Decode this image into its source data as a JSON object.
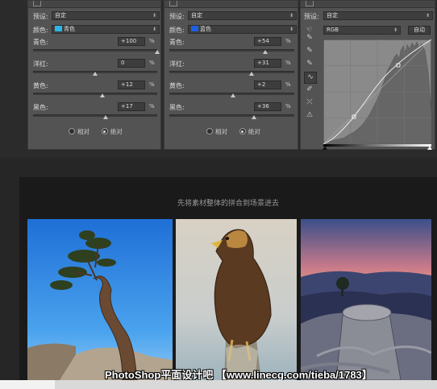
{
  "panel1": {
    "preset_label": "预设:",
    "preset_value": "自定",
    "color_label": "颜色:",
    "color_value": "青色",
    "color_swatch": "#2bb8e8",
    "sliders": [
      {
        "label": "青色:",
        "value": "+100",
        "unit": "%",
        "level": 1.0
      },
      {
        "label": "洋红:",
        "value": "0",
        "unit": "%",
        "level": 0.5
      },
      {
        "label": "黄色:",
        "value": "+12",
        "unit": "%",
        "level": 0.56
      },
      {
        "label": "黑色:",
        "value": "+17",
        "unit": "%",
        "level": 0.585
      }
    ],
    "radio_relative": "相对",
    "radio_absolute": "绝对",
    "selected": "absolute"
  },
  "panel2": {
    "preset_label": "预设:",
    "preset_value": "自定",
    "color_label": "颜色:",
    "color_value": "蓝色",
    "color_swatch": "#1f5fe0",
    "sliders": [
      {
        "label": "青色:",
        "value": "+54",
        "unit": "%",
        "level": 0.77
      },
      {
        "label": "洋红:",
        "value": "+31",
        "unit": "%",
        "level": 0.655
      },
      {
        "label": "黄色:",
        "value": "+2",
        "unit": "%",
        "level": 0.51
      },
      {
        "label": "黑色:",
        "value": "+36",
        "unit": "%",
        "level": 0.68
      }
    ],
    "radio_relative": "相对",
    "radio_absolute": "绝对",
    "selected": "absolute"
  },
  "panel3": {
    "preset_label": "预设:",
    "preset_value": "自定",
    "channel_value": "RGB",
    "auto_button": "自动",
    "tool_icons": [
      "target-adjust-icon",
      "eyedropper-black-icon",
      "eyedropper-gray-icon",
      "eyedropper-white-icon",
      "curve-point-icon",
      "pencil-icon",
      "smooth-icon",
      "clipping-warning-icon"
    ]
  },
  "lower": {
    "caption": "先将素材整体的拼合到场景进去",
    "photos": [
      {
        "name": "juniper-tree-photo"
      },
      {
        "name": "golden-eagle-photo"
      },
      {
        "name": "tree-stump-sunset-photo"
      }
    ],
    "watermark": "PhotoShop平面设计吧 【www.linecg.com/tieba/1783】"
  }
}
